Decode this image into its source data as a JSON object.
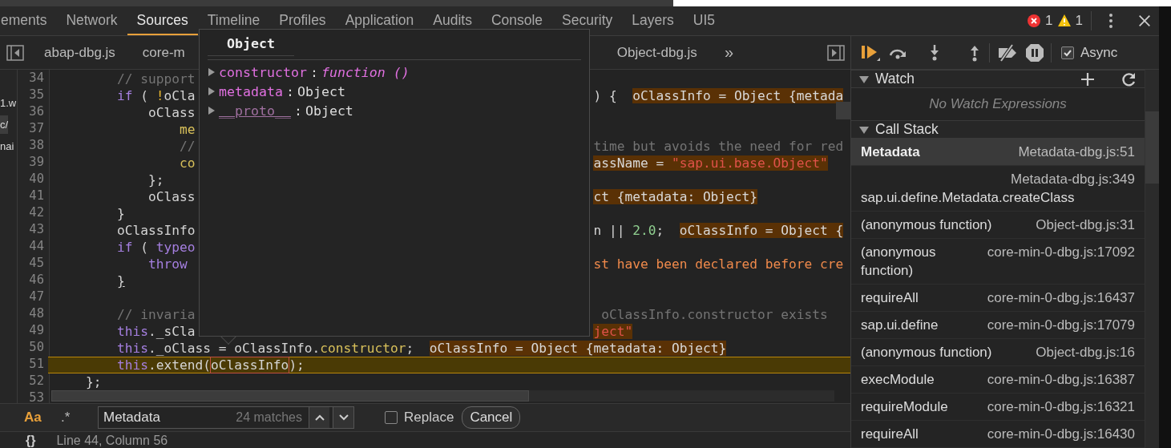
{
  "main_tabs": [
    {
      "label": "ements",
      "selected": false
    },
    {
      "label": "Network",
      "selected": false
    },
    {
      "label": "Sources",
      "selected": true
    },
    {
      "label": "Timeline",
      "selected": false
    },
    {
      "label": "Profiles",
      "selected": false
    },
    {
      "label": "Application",
      "selected": false
    },
    {
      "label": "Audits",
      "selected": false
    },
    {
      "label": "Console",
      "selected": false
    },
    {
      "label": "Security",
      "selected": false
    },
    {
      "label": "Layers",
      "selected": false
    },
    {
      "label": "UI5",
      "selected": false
    }
  ],
  "counters": {
    "errors": "1",
    "warnings": "1"
  },
  "file_tabs": [
    {
      "label": "abap-dbg.js"
    },
    {
      "label": "core-m"
    },
    {
      "label": "Object-dbg.js"
    }
  ],
  "more_tabs": "»",
  "navigator": [
    {
      "label": "1.w",
      "selected": false
    },
    {
      "label": "c/",
      "selected": true
    },
    {
      "label": "nai",
      "selected": false
    }
  ],
  "code": [
    {
      "n": "34",
      "left": [
        {
          "kind": "comment",
          "text": "// support"
        }
      ]
    },
    {
      "n": "35",
      "left": [
        {
          "kind": "keyword",
          "text": "if"
        },
        {
          "kind": "plain",
          "text": " ( "
        },
        {
          "kind": "operator",
          "text": "!"
        },
        {
          "kind": "plain",
          "text": "oCla"
        }
      ],
      "right": [
        {
          "kind": "plain",
          "text": ") {  "
        },
        {
          "kind": "value",
          "text": "oClassInfo = Object {metada"
        }
      ]
    },
    {
      "n": "36",
      "left": [
        {
          "kind": "plain",
          "text": "oClass"
        }
      ]
    },
    {
      "n": "37",
      "left": [
        {
          "kind": "property",
          "text": "me"
        }
      ]
    },
    {
      "n": "38",
      "left": [
        {
          "kind": "comment",
          "text": "//"
        }
      ],
      "right": [
        {
          "kind": "comment",
          "text": "time but avoids the need for red"
        }
      ]
    },
    {
      "n": "39",
      "left": [
        {
          "kind": "property",
          "text": "co"
        }
      ],
      "right": [
        {
          "kind": "value",
          "text": "assName = "
        },
        {
          "kind": "value-string",
          "text": "\"sap.ui.base.Object\""
        }
      ]
    },
    {
      "n": "40",
      "left": [
        {
          "kind": "plain",
          "text": "};"
        }
      ]
    },
    {
      "n": "41",
      "left": [
        {
          "kind": "plain",
          "text": "oClass"
        }
      ],
      "right": [
        {
          "kind": "value",
          "text": "ct {metadata: Object}"
        }
      ]
    },
    {
      "n": "42",
      "left": [
        {
          "kind": "plain",
          "text": "}"
        }
      ]
    },
    {
      "n": "43",
      "left": [
        {
          "kind": "plain",
          "text": "oClassInfo"
        }
      ],
      "right": [
        {
          "kind": "plain",
          "text": "n || "
        },
        {
          "kind": "number",
          "text": "2.0"
        },
        {
          "kind": "plain",
          "text": ";  "
        },
        {
          "kind": "value",
          "text": "oClassInfo = Object {"
        }
      ]
    },
    {
      "n": "44",
      "left": [
        {
          "kind": "keyword",
          "text": "if"
        },
        {
          "kind": "plain",
          "text": " ( "
        },
        {
          "kind": "keyword",
          "text": "typeo"
        }
      ]
    },
    {
      "n": "45",
      "left": [
        {
          "kind": "keyword",
          "text": "throw"
        }
      ],
      "right": [
        {
          "kind": "error",
          "text": "st have been declared before cre"
        }
      ]
    },
    {
      "n": "46",
      "left": [
        {
          "kind": "brace",
          "text": "}"
        }
      ]
    },
    {
      "n": "47"
    },
    {
      "n": "48",
      "left": [
        {
          "kind": "comment",
          "text": "// invaria"
        }
      ],
      "right": [
        {
          "kind": "comment",
          "text": "oClassInfo.constructor exists"
        }
      ]
    },
    {
      "n": "49",
      "left": [
        {
          "kind": "keyword",
          "text": "this"
        },
        {
          "kind": "plain",
          "text": "._sCla"
        }
      ],
      "right": [
        {
          "kind": "value-string",
          "text": "ject\""
        }
      ]
    },
    {
      "n": "50",
      "left": [
        {
          "kind": "keyword",
          "text": "this"
        },
        {
          "kind": "plain",
          "text": "._oClass = oClassInfo."
        },
        {
          "kind": "property",
          "text": "constructor"
        },
        {
          "kind": "plain",
          "text": ";  "
        },
        {
          "kind": "value",
          "text": "oClassInfo = Object {metadata: Object}"
        }
      ]
    },
    {
      "n": "51",
      "current": true,
      "left": [
        {
          "kind": "keyword",
          "text": "this"
        },
        {
          "kind": "plain",
          "text": ".extend("
        },
        {
          "kind": "hover",
          "text": "oClassInfo"
        },
        {
          "kind": "plain",
          "text": ");"
        }
      ]
    },
    {
      "n": "52",
      "left": [
        {
          "kind": "plain",
          "text": "};"
        }
      ]
    },
    {
      "n": "53"
    }
  ],
  "popover": {
    "title": "Object",
    "entries": [
      {
        "key": "constructor",
        "separator": ":",
        "value": "function ()",
        "kind": "function"
      },
      {
        "key": "metadata",
        "separator": ":",
        "value": "Object",
        "kind": "object"
      },
      {
        "key": "__proto__",
        "separator": ":",
        "value": "Object",
        "kind": "proto"
      }
    ]
  },
  "search": {
    "case_label": "Aa",
    "regex_label": ".*",
    "value": "Metadata",
    "matches": "24 matches",
    "replace_label": "Replace",
    "replace_checked": false,
    "cancel": "Cancel"
  },
  "status": {
    "braces": "{}",
    "position": "Line 44, Column 56"
  },
  "debugger": {
    "async_label": "Async",
    "async_checked": true
  },
  "watch": {
    "title": "Watch",
    "expanded": true,
    "empty": "No Watch Expressions"
  },
  "call_stack": {
    "title": "Call Stack",
    "expanded": true,
    "frames": [
      {
        "name": "Metadata",
        "location": "Metadata-dbg.js:51",
        "selected": true
      },
      {
        "name": "sap.ui.define.Metadata.createClass",
        "location": "Metadata-dbg.js:349",
        "selected": false
      },
      {
        "name": "(anonymous function)",
        "location": "Object-dbg.js:31",
        "selected": false
      },
      {
        "name": "(anonymous function)",
        "location": "core-min-0-dbg.js:17092",
        "selected": false
      },
      {
        "name": "requireAll",
        "location": "core-min-0-dbg.js:16437",
        "selected": false
      },
      {
        "name": "sap.ui.define",
        "location": "core-min-0-dbg.js:17079",
        "selected": false
      },
      {
        "name": "(anonymous function)",
        "location": "Object-dbg.js:16",
        "selected": false
      },
      {
        "name": "execModule",
        "location": "core-min-0-dbg.js:16387",
        "selected": false
      },
      {
        "name": "requireModule",
        "location": "core-min-0-dbg.js:16321",
        "selected": false
      },
      {
        "name": "requireAll",
        "location": "core-min-0-dbg.js:16430",
        "selected": false
      }
    ]
  }
}
